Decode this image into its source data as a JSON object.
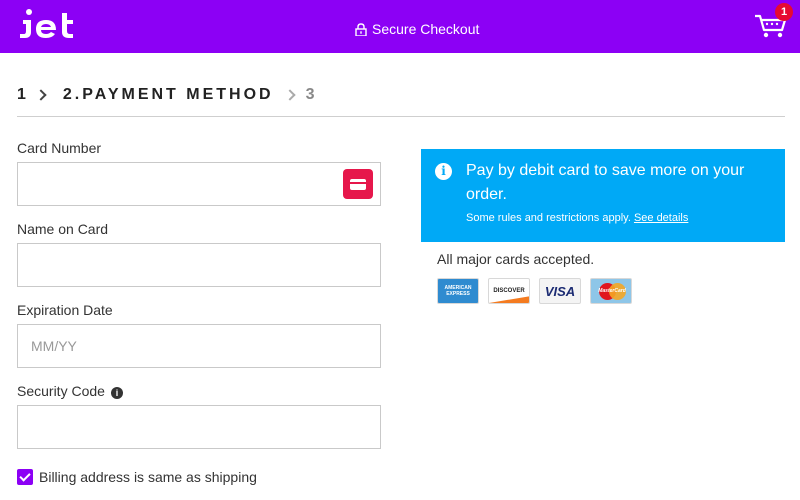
{
  "header": {
    "logo_alt": "jet",
    "secure_label": "Secure Checkout",
    "cart_count": "1",
    "brand_color": "#8c00f5"
  },
  "steps": {
    "prev": "1",
    "current": "2.PAYMENT METHOD",
    "next": "3"
  },
  "form": {
    "card_number": {
      "label": "Card Number",
      "value": "",
      "placeholder": ""
    },
    "name_on_card": {
      "label": "Name on Card",
      "value": "",
      "placeholder": ""
    },
    "expiration": {
      "label": "Expiration Date",
      "value": "",
      "placeholder": "MM/YY"
    },
    "security_code": {
      "label": "Security Code",
      "value": "",
      "placeholder": ""
    },
    "billing_same": {
      "label": "Billing address is same as shipping",
      "checked": true
    }
  },
  "promo": {
    "title": "Pay by debit card to save more on your order.",
    "note": "Some rules and restrictions apply.",
    "link": "See details",
    "color": "#00a9f6"
  },
  "cards": {
    "accepted_text": "All major cards accepted.",
    "amex": "AMERICAN EXPRESS",
    "discover": "DISCOVER",
    "visa": "VISA",
    "mastercard": "MasterCard"
  }
}
